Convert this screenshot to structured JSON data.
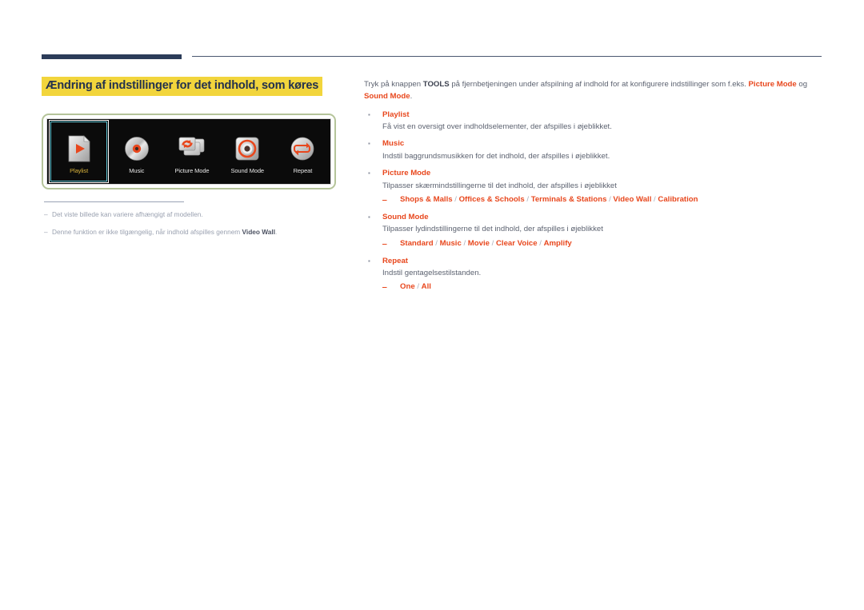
{
  "section": {
    "title": "Ændring af indstillinger for det indhold, som køres",
    "title_bg": "#f2d53c",
    "title_color": "#22304d"
  },
  "figure": {
    "border_color": "#b5c49a",
    "panel_bg": "#0b0b0b",
    "selected_color": "#5fc7d6",
    "selected_label_color": "#d9b33c",
    "tiles": [
      {
        "label": "Playlist",
        "icon": "playlist-page-play-icon",
        "selected": true
      },
      {
        "label": "Music",
        "icon": "music-disc-icon",
        "selected": false
      },
      {
        "label": "Picture Mode",
        "icon": "picture-mode-screens-refresh-icon",
        "selected": false
      },
      {
        "label": "Sound Mode",
        "icon": "sound-mode-speaker-icon",
        "selected": false
      },
      {
        "label": "Repeat",
        "icon": "repeat-loop-icon",
        "selected": false
      }
    ]
  },
  "footnotes": [
    {
      "dash": "‒",
      "text": "Det viste billede kan variere afhængigt af modellen."
    },
    {
      "dash": "‒",
      "pre": "Denne funktion er ikke tilgængelig, når indhold afspilles gennem ",
      "bold": "Video Wall",
      "post": "."
    }
  ],
  "intro": {
    "p1": "Tryk på knappen ",
    "tools": "TOOLS",
    "p2": " på fjernbetjeningen under afspilning af indhold for at konfigurere indstillinger som f.eks. ",
    "kw1": "Picture Mode",
    "p3": " og ",
    "kw2": "Sound Mode",
    "p4": "."
  },
  "bullets": [
    {
      "marker": "▪",
      "head": "Playlist",
      "desc": "Få vist en oversigt over indholdselementer, der afspilles i øjeblikket."
    },
    {
      "marker": "▪",
      "head": "Music",
      "desc": "Indstil baggrundsmusikken for det indhold, der afspilles i øjeblikket."
    },
    {
      "marker": "▪",
      "head": "Picture Mode",
      "desc": "Tilpasser skærmindstillingerne til det indhold, der afspilles i øjeblikket",
      "sub": {
        "dash": "‒",
        "options": [
          "Shops & Malls",
          "Offices & Schools",
          "Terminals & Stations",
          "Video Wall",
          "Calibration"
        ]
      }
    },
    {
      "marker": "▪",
      "head": "Sound Mode",
      "desc": "Tilpasser lydindstillingerne til det indhold, der afspilles i øjeblikket",
      "sub": {
        "dash": "‒",
        "options": [
          "Standard",
          "Music",
          "Movie",
          "Clear Voice",
          "Amplify"
        ]
      }
    },
    {
      "marker": "▪",
      "head": "Repeat",
      "desc": "Indstil gentagelsestilstanden.",
      "sub": {
        "dash": "‒",
        "options": [
          "One",
          "All"
        ]
      }
    }
  ],
  "colors": {
    "keyword": "#e8471d",
    "body": "#5c6270",
    "rule_dark": "#2c3c59"
  }
}
